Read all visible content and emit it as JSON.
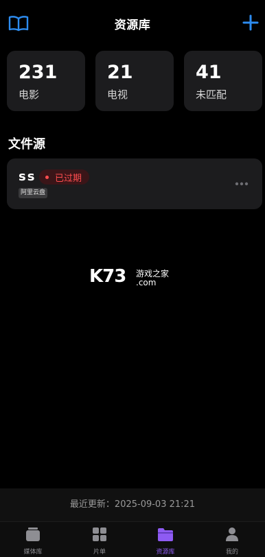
{
  "header": {
    "title": "资源库",
    "left_icon": "book-icon",
    "right_icon": "plus-icon",
    "accent": "#2d8cf0"
  },
  "stats": [
    {
      "value": "231",
      "label": "电影"
    },
    {
      "value": "21",
      "label": "电视"
    },
    {
      "value": "41",
      "label": "未匹配"
    }
  ],
  "section": {
    "title": "文件源"
  },
  "sources": [
    {
      "name": "ss",
      "status": "已过期",
      "status_color": "#ff4d4f",
      "tag": "阿里云盘",
      "menu_icon": "more-icon"
    }
  ],
  "watermark": {
    "brand": "K73",
    "text": "游戏之家",
    "domain": ".com"
  },
  "footer": {
    "update_text": "最近更新：2025-09-03 21:21"
  },
  "tabbar": {
    "active_color": "#8e5bf3",
    "tabs": [
      {
        "label": "媒体库",
        "icon": "media-library-icon"
      },
      {
        "label": "片单",
        "icon": "grid-icon"
      },
      {
        "label": "资源库",
        "icon": "folder-icon"
      },
      {
        "label": "我的",
        "icon": "person-icon"
      }
    ]
  }
}
